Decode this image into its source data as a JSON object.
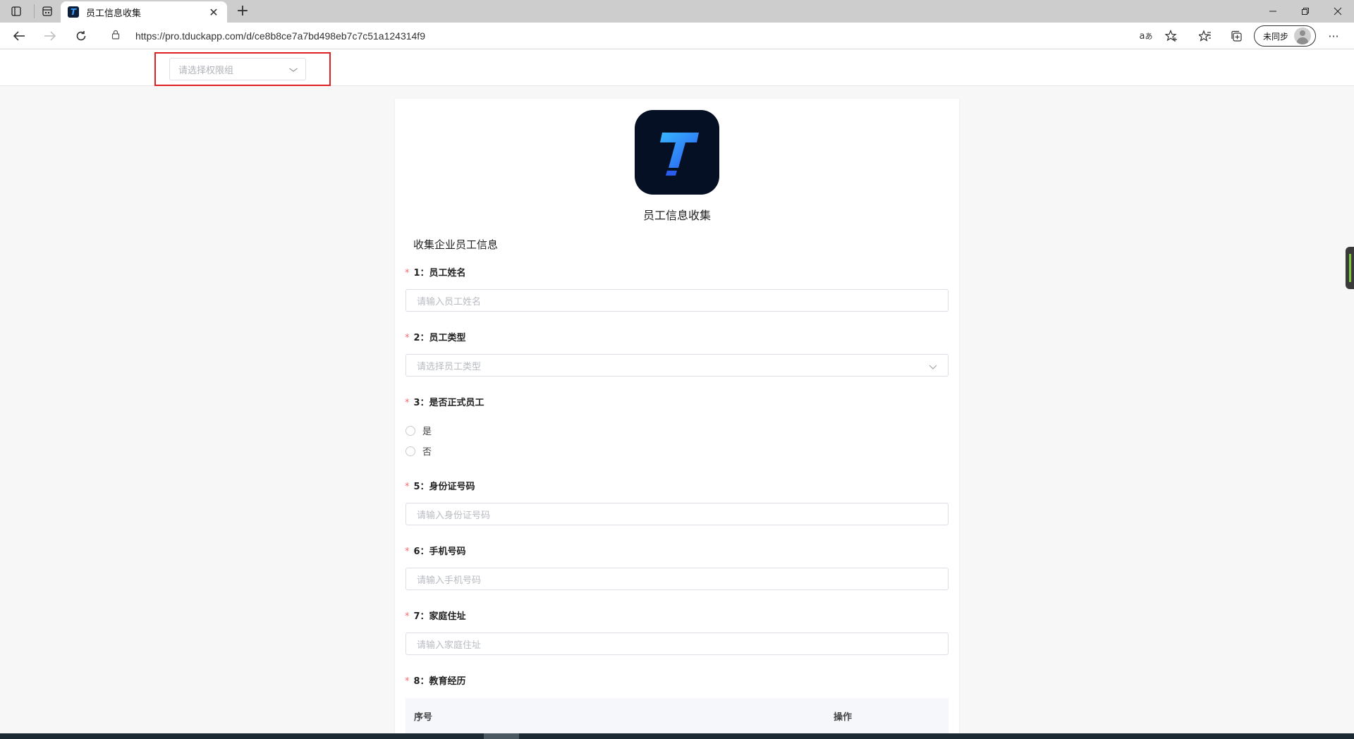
{
  "browser": {
    "tab_title": "员工信息收集",
    "url": "https://pro.tduckapp.com/d/ce8b8ce7a7bd498eb7c7c51a124314f9",
    "profile_label": "未同步"
  },
  "header": {
    "permission_select_placeholder": "请选择权限组"
  },
  "form": {
    "logo_letter": "T",
    "title": "员工信息收集",
    "description": "收集企业员工信息",
    "questions": [
      {
        "label": "1：员工姓名",
        "placeholder": "请输入员工姓名"
      },
      {
        "label": "2：员工类型",
        "placeholder": "请选择员工类型"
      },
      {
        "label": "3：是否正式员工",
        "options": [
          "是",
          "否"
        ]
      },
      {
        "label": "5：身份证号码",
        "placeholder": "请输入身份证号码"
      },
      {
        "label": "6：手机号码",
        "placeholder": "请输入手机号码"
      },
      {
        "label": "7：家庭住址",
        "placeholder": "请输入家庭住址"
      },
      {
        "label": "8：教育经历",
        "columns": [
          "序号",
          "操作"
        ]
      }
    ],
    "required_mark": "*"
  },
  "colors": {
    "highlight": "#e02020",
    "required": "#f56c6c",
    "logo_bg": "#061024",
    "logo_letter": "#2f8cff"
  }
}
